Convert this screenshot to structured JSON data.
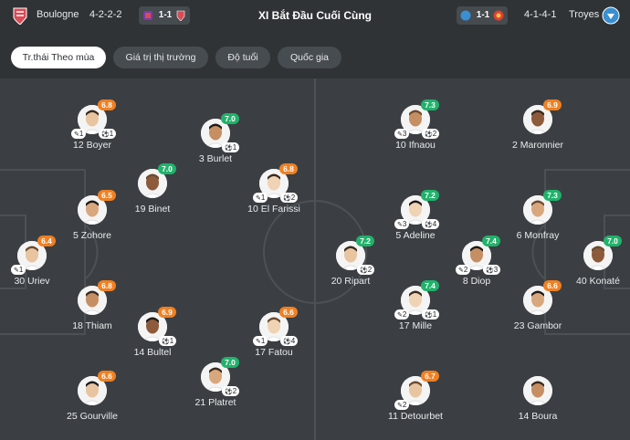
{
  "header": {
    "home_team": "Boulogne",
    "home_formation": "4-2-2-2",
    "home_score": "1-1",
    "title": "XI Bắt Đầu Cuối Cùng",
    "away_score": "1-1",
    "away_formation": "4-1-4-1",
    "away_team": "Troyes"
  },
  "colors": {
    "green": "#21b26b",
    "orange": "#f08022",
    "pitch": "#3b3f43",
    "header": "#2f3336"
  },
  "tabs": [
    "Tr.thái Theo mùa",
    "Giá trị thị trường",
    "Độ tuổi",
    "Quốc gia"
  ],
  "players": [
    {
      "name": "12 Boyer",
      "rating": "6.8",
      "color": "orange",
      "left": "1",
      "right": "1"
    },
    {
      "name": "3 Burlet",
      "rating": "7.0",
      "color": "green",
      "left": "",
      "right": "1"
    },
    {
      "name": "19 Binet",
      "rating": "7.0",
      "color": "green",
      "left": "",
      "right": ""
    },
    {
      "name": "10 El Farissi",
      "rating": "6.8",
      "color": "orange",
      "left": "1",
      "right": "2"
    },
    {
      "name": "5 Zohore",
      "rating": "6.5",
      "color": "orange",
      "left": "",
      "right": ""
    },
    {
      "name": "30 Uriev",
      "rating": "6.4",
      "color": "orange",
      "left": "1",
      "right": ""
    },
    {
      "name": "18 Thiam",
      "rating": "6.8",
      "color": "orange",
      "left": "",
      "right": ""
    },
    {
      "name": "14 Bultel",
      "rating": "6.9",
      "color": "orange",
      "left": "",
      "right": "1"
    },
    {
      "name": "17 Fatou",
      "rating": "6.6",
      "color": "orange",
      "left": "1",
      "right": "4"
    },
    {
      "name": "21 Platret",
      "rating": "7.0",
      "color": "green",
      "left": "",
      "right": "2"
    },
    {
      "name": "25 Gourville",
      "rating": "6.6",
      "color": "orange",
      "left": "",
      "right": ""
    },
    {
      "name": "10 Ifnaou",
      "rating": "7.3",
      "color": "green",
      "left": "3",
      "right": "2"
    },
    {
      "name": "2 Maronnier",
      "rating": "6.9",
      "color": "orange",
      "left": "",
      "right": ""
    },
    {
      "name": "5 Adeline",
      "rating": "7.2",
      "color": "green",
      "left": "3",
      "right": "4"
    },
    {
      "name": "6 Monfray",
      "rating": "7.3",
      "color": "green",
      "left": "",
      "right": ""
    },
    {
      "name": "20 Ripart",
      "rating": "7.2",
      "color": "green",
      "left": "",
      "right": "2"
    },
    {
      "name": "8 Diop",
      "rating": "7.4",
      "color": "green",
      "left": "2",
      "right": "3"
    },
    {
      "name": "40 Konaté",
      "rating": "7.0",
      "color": "green",
      "left": "",
      "right": ""
    },
    {
      "name": "17 Mille",
      "rating": "7.4",
      "color": "green",
      "left": "2",
      "right": "1"
    },
    {
      "name": "23 Gambor",
      "rating": "6.6",
      "color": "orange",
      "left": "",
      "right": ""
    },
    {
      "name": "11 Detourbet",
      "rating": "6.7",
      "color": "orange",
      "left": "2",
      "right": ""
    },
    {
      "name": "14 Boura",
      "rating": "",
      "color": "",
      "left": "",
      "right": ""
    }
  ]
}
